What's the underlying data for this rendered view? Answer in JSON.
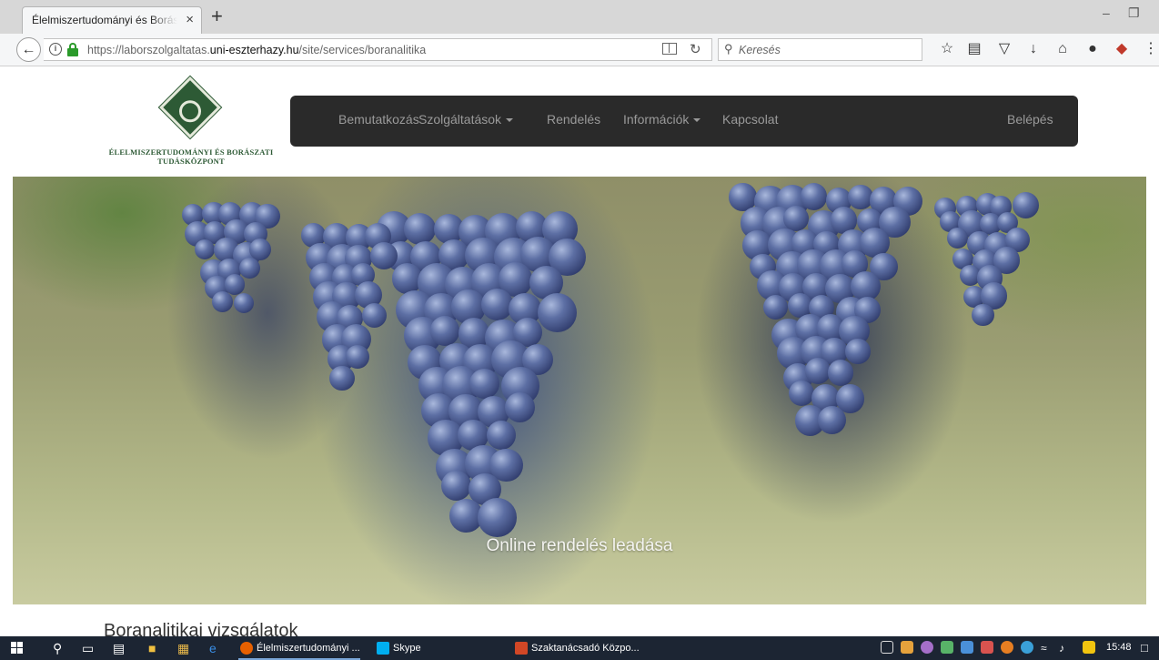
{
  "browser": {
    "tab_title": "Élelmiszertudományi és Borászati",
    "tab_close": "×",
    "new_tab": "+",
    "url_prefix": "https://laborszolgaltatas.",
    "url_domain": "uni-eszterhazy.hu",
    "url_path": "/site/services/boranalitika",
    "search_placeholder": "Keresés",
    "toolbar_icons": [
      "bookmark-star-icon",
      "bookmarks-list-icon",
      "pocket-icon",
      "downloads-icon",
      "home-icon",
      "extension-icon",
      "ublock-icon",
      "menu-icon"
    ]
  },
  "site": {
    "logo_line1": "ÉLELMISZERTUDOMÁNYI ÉS BORÁSZATI",
    "logo_line2": "TUDÁSKÖZPONT",
    "nav": {
      "intro": "Bemutatkozás",
      "services": "Szolgáltatások",
      "order": "Rendelés",
      "info": "Információk",
      "contact": "Kapcsolat",
      "login": "Belépés"
    },
    "hero_caption": "Online rendelés leadása",
    "section_title": "Boranalitikai vizsgálatok"
  },
  "taskbar": {
    "apps": [
      {
        "label": "Élelmiszertudományi ...",
        "color": "#e66000"
      },
      {
        "label": "Skype",
        "color": "#00aff0"
      },
      {
        "label": "Szaktanácsadó Közpo...",
        "color": "#d24726"
      }
    ],
    "clock": "15:48"
  },
  "colors": {
    "nav_bg": "#2a2a2a",
    "nav_text": "#9a9a9a",
    "logo_green": "#2d5a35",
    "taskbar_bg": "#1c2533"
  }
}
